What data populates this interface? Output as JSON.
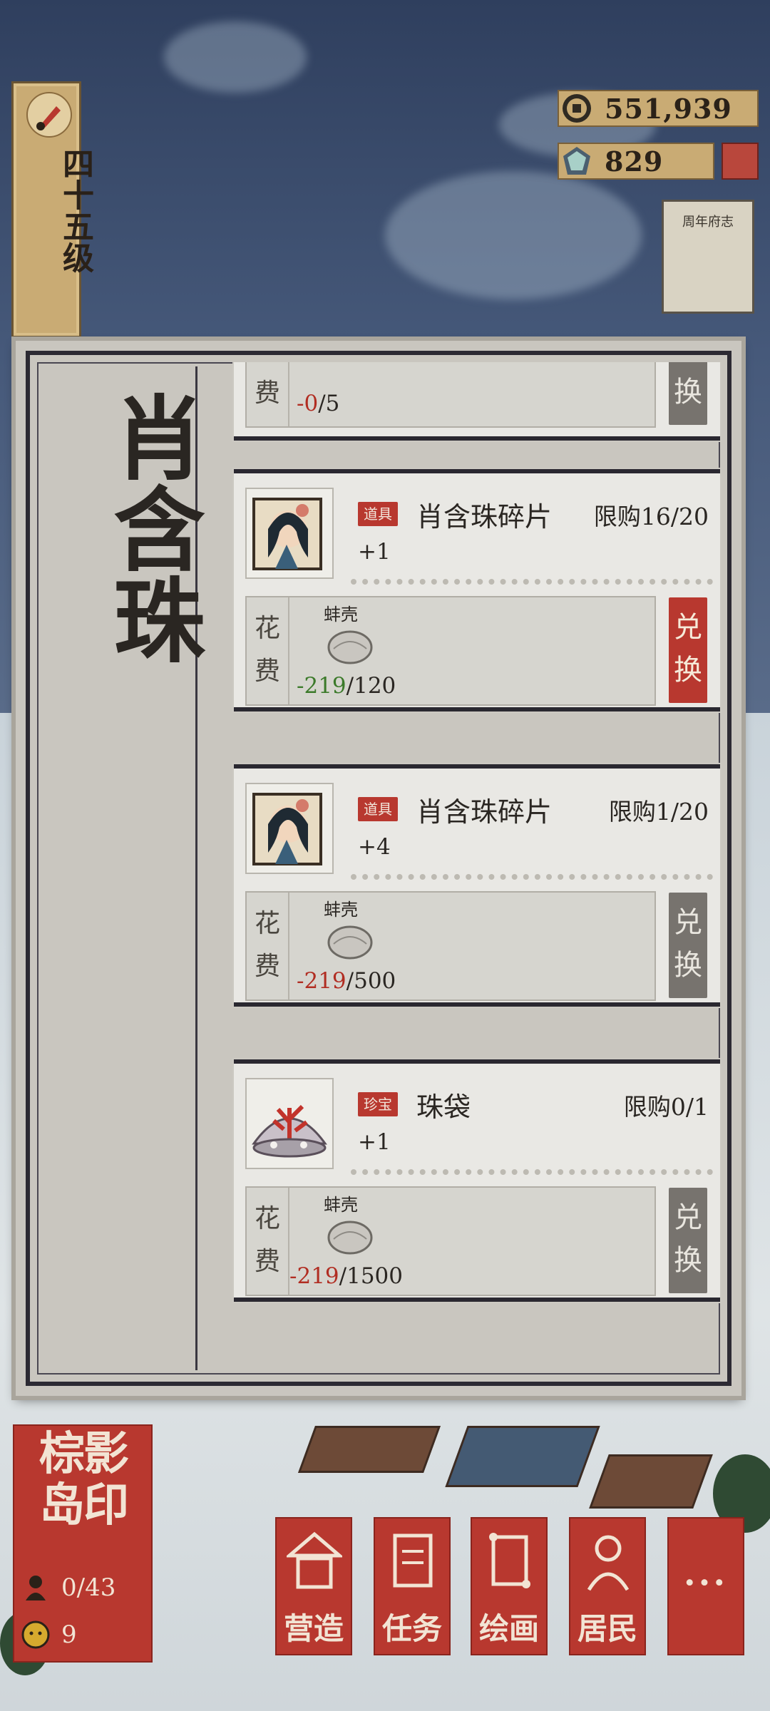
{
  "level": {
    "label": "四十五级",
    "icon": "brush-icon"
  },
  "currencies": [
    {
      "icon": "copper-coin-icon",
      "value": "551,939"
    },
    {
      "icon": "jade-gem-icon",
      "value": "829"
    }
  ],
  "side": {
    "mailbox_icon": "shop-box-icon",
    "card_label": "周年府志"
  },
  "panel": {
    "title": "肖含珠",
    "cost_label": "花费",
    "items": [
      {
        "partial": true,
        "cost_value_spent": "-0",
        "cost_value_required": "/5",
        "button": "兑换",
        "button_active": false
      },
      {
        "tag": "道具",
        "name": "肖含珠碎片",
        "limit": "限购16/20",
        "gain": "+1",
        "resource_name": "蚌壳",
        "cost_value_spent": "-219",
        "cost_value_required": "/120",
        "cost_ok": true,
        "button": "兑换",
        "button_active": true,
        "thumb_icon": "portrait-fragment-icon"
      },
      {
        "tag": "道具",
        "name": "肖含珠碎片",
        "limit": "限购1/20",
        "gain": "+4",
        "resource_name": "蚌壳",
        "cost_value_spent": "-219",
        "cost_value_required": "/500",
        "cost_ok": false,
        "button": "兑换",
        "button_active": false,
        "thumb_icon": "portrait-fragment-icon"
      },
      {
        "tag": "珍宝",
        "name": "珠袋",
        "limit": "限购0/1",
        "gain": "+1",
        "resource_name": "蚌壳",
        "cost_value_spent": "-219",
        "cost_value_required": "/1500",
        "cost_ok": false,
        "button": "兑换",
        "button_active": false,
        "thumb_icon": "coral-shell-icon"
      }
    ]
  },
  "island": {
    "name_line1": "棕影",
    "name_line2": "岛印",
    "residents": "0/43",
    "coins": "9"
  },
  "nav": [
    {
      "label": "营造",
      "icon": "pavilion-icon"
    },
    {
      "label": "任务",
      "icon": "book-icon"
    },
    {
      "label": "绘画",
      "icon": "scroll-icon"
    },
    {
      "label": "居民",
      "icon": "resident-icon"
    },
    {
      "label": "···",
      "icon": "more-icon"
    }
  ]
}
